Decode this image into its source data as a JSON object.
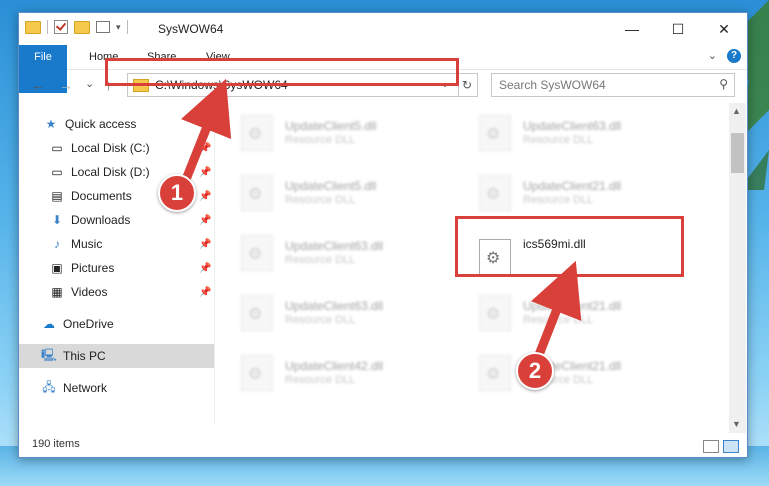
{
  "window": {
    "title": "SysWOW64"
  },
  "ribbon": {
    "tabs": [
      "File",
      "Home",
      "Share",
      "View"
    ],
    "help_label": "?"
  },
  "navbar": {
    "back": "←",
    "forward": "→",
    "recent": "⌄",
    "up": "↑",
    "address": "C:\\Windows\\SysWOW64",
    "refresh": "↻",
    "search_placeholder": "Search SysWOW64"
  },
  "sidebar": {
    "items": [
      {
        "label": "Quick access",
        "icon": "star-icon"
      },
      {
        "label": "Local Disk (C:)",
        "icon": "drive-icon"
      },
      {
        "label": "Local Disk (D:)",
        "icon": "drive-icon"
      },
      {
        "label": "Documents",
        "icon": "documents-icon"
      },
      {
        "label": "Downloads",
        "icon": "download-icon"
      },
      {
        "label": "Music",
        "icon": "music-icon"
      },
      {
        "label": "Pictures",
        "icon": "pictures-icon"
      },
      {
        "label": "Videos",
        "icon": "videos-icon"
      },
      {
        "label": "OneDrive",
        "icon": "cloud-icon"
      },
      {
        "label": "This PC",
        "icon": "computer-icon"
      },
      {
        "label": "Network",
        "icon": "network-icon"
      }
    ]
  },
  "files": [
    {
      "name": "UpdateClient5.dll",
      "type": "Resource DLL"
    },
    {
      "name": "UpdateClient63.dll",
      "type": "Resource DLL"
    },
    {
      "name": "UpdateClient5.dll",
      "type": "Resource DLL"
    },
    {
      "name": "UpdateClient21.dll",
      "type": "Resource DLL"
    },
    {
      "name": "UpdateClient63.dll",
      "type": "Resource DLL"
    },
    {
      "name": "ics569mi.dll",
      "type": ""
    },
    {
      "name": "UpdateClient63.dll",
      "type": "Resource DLL"
    },
    {
      "name": "UpdateClient21.dll",
      "type": "Resource DLL"
    },
    {
      "name": "UpdateClient42.dll",
      "type": "Resource DLL"
    },
    {
      "name": "UpdateClient21.dll",
      "type": "Resource DLL"
    }
  ],
  "status": {
    "item_count": "190 items"
  },
  "annotations": {
    "step1": "1",
    "step2": "2"
  },
  "colors": {
    "accent": "#1979ca",
    "highlight": "#d9403a"
  }
}
